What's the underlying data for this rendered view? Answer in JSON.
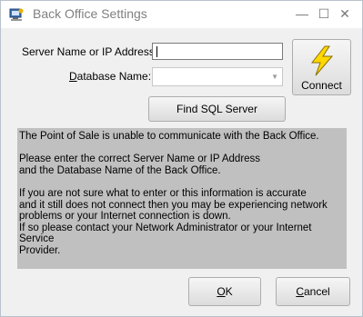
{
  "window": {
    "title": "Back Office Settings"
  },
  "titlebar": {
    "minimize": "—",
    "maximize": "☐",
    "close": "✕"
  },
  "form": {
    "server_label": "Server Name or IP Address:",
    "server_value": "",
    "database_label_pre": "",
    "database_label_accel": "D",
    "database_label_post": "atabase Name:",
    "database_value": ""
  },
  "buttons": {
    "connect": "Connect",
    "find_sql": "Find SQL Server",
    "ok": "OK",
    "cancel": "Cancel"
  },
  "message": {
    "paragraphs": [
      "The Point of Sale is unable to communicate with the Back Office.",
      "Please enter the correct Server Name or IP Address\nand the Database Name of the Back Office.",
      "If you are not sure what to enter or this information is accurate\nand it still does not connect then you may be experiencing network\nproblems or your Internet connection is down.\nIf so please contact your Network Administrator or your Internet Service\nProvider."
    ]
  },
  "icons": {
    "app": "app-icon",
    "connect": "lightning-bolt-icon"
  },
  "colors": {
    "desktop": "#0a5eb4",
    "message_bg": "#c0c0c0",
    "bolt": "#ffd800"
  }
}
